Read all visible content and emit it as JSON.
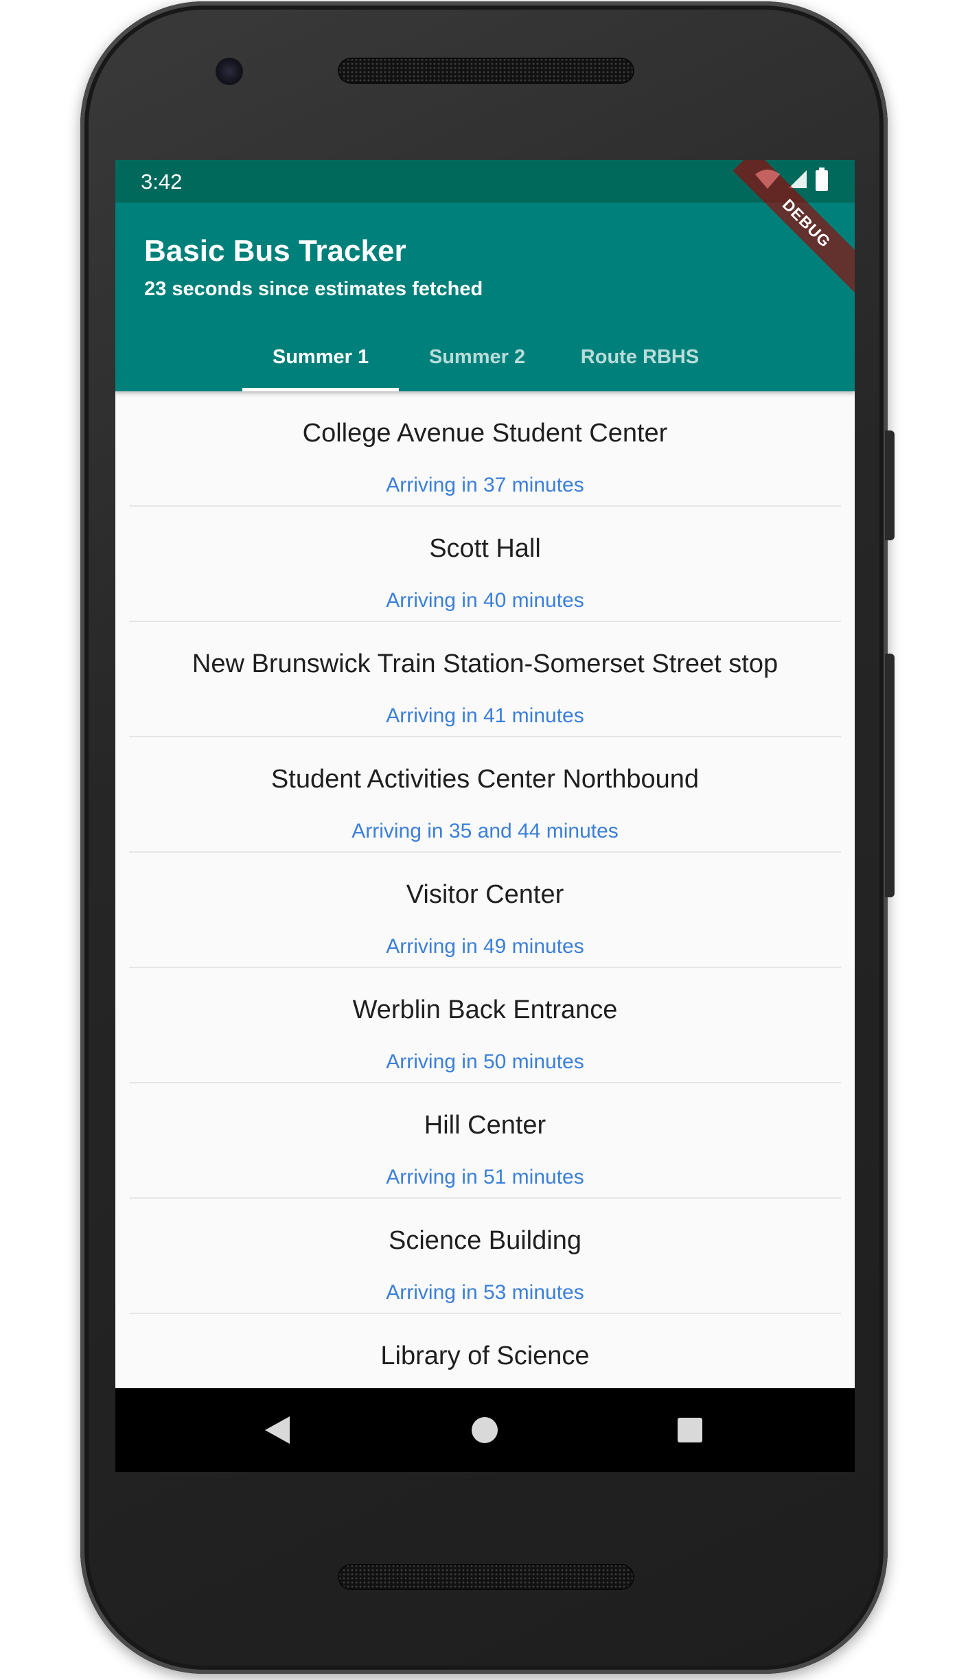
{
  "status_bar": {
    "time": "3:42"
  },
  "app_bar": {
    "title": "Basic Bus Tracker",
    "subtitle": "23 seconds since estimates fetched",
    "debug_label": "DEBUG"
  },
  "tabs": [
    {
      "label": "Summer 1",
      "active": true
    },
    {
      "label": "Summer 2",
      "active": false
    },
    {
      "label": "Route RBHS",
      "active": false
    }
  ],
  "stops": [
    {
      "name": "College Avenue Student Center",
      "eta": "Arriving in 37 minutes"
    },
    {
      "name": "Scott Hall",
      "eta": "Arriving in 40 minutes"
    },
    {
      "name": "New Brunswick Train Station-Somerset Street stop",
      "eta": "Arriving in 41 minutes"
    },
    {
      "name": "Student Activities Center Northbound",
      "eta": "Arriving in 35 and 44 minutes"
    },
    {
      "name": "Visitor Center",
      "eta": "Arriving in 49 minutes"
    },
    {
      "name": "Werblin Back Entrance",
      "eta": "Arriving in 50 minutes"
    },
    {
      "name": "Hill Center",
      "eta": "Arriving in 51 minutes"
    },
    {
      "name": "Science Building",
      "eta": "Arriving in 53 minutes"
    },
    {
      "name": "Library of Science",
      "eta": ""
    }
  ],
  "icons": {
    "wifi": "wifi-icon",
    "signal": "cell-signal-icon",
    "battery": "battery-icon",
    "back": "back-icon",
    "home": "home-icon",
    "recents": "recents-icon"
  },
  "colors": {
    "status_bar": "#00695c",
    "app_bar": "#00807a",
    "eta_text": "#3b7fd9",
    "stop_text": "#1f1f1f",
    "debug_ribbon": "#a00000"
  }
}
